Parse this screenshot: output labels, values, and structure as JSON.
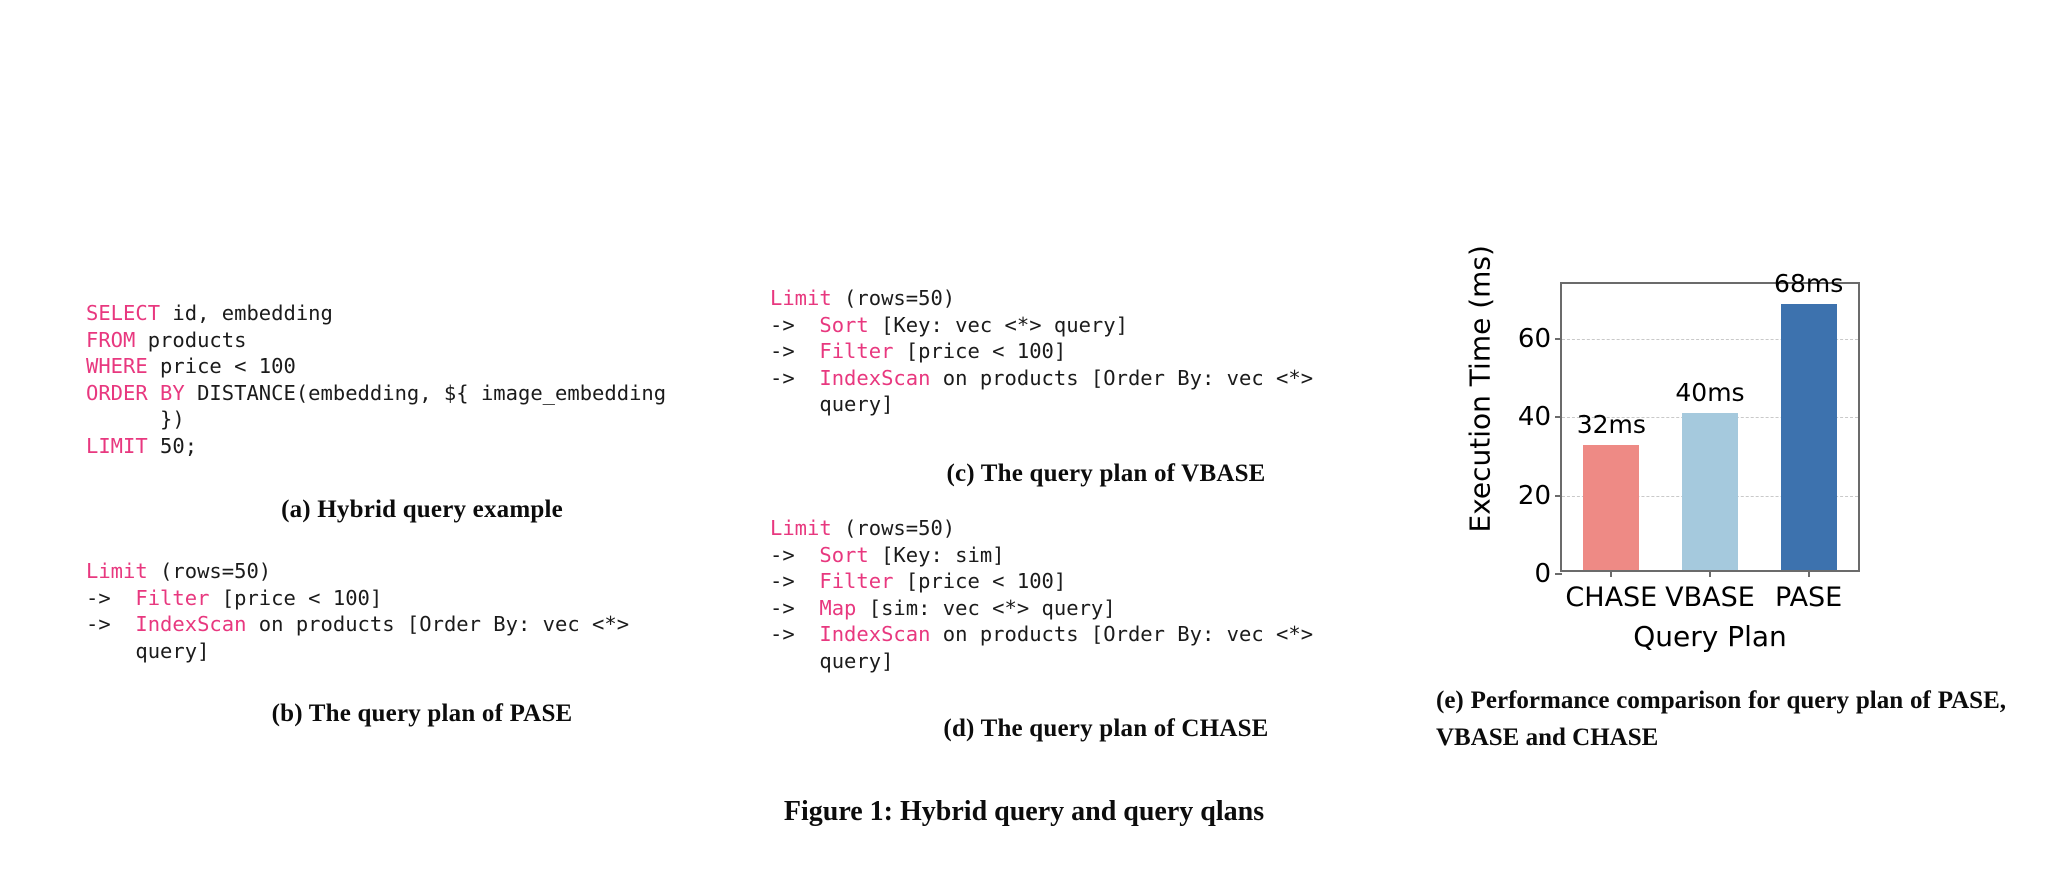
{
  "figure": {
    "caption": "Figure 1: Hybrid query and query qlans"
  },
  "panel_a": {
    "caption": "(a) Hybrid query example",
    "lines": [
      [
        {
          "t": "SELECT",
          "c": "kw"
        },
        {
          "t": " id, embedding",
          "c": "op"
        }
      ],
      [
        {
          "t": "FROM",
          "c": "kw"
        },
        {
          "t": " products",
          "c": "op"
        }
      ],
      [
        {
          "t": "WHERE",
          "c": "kw"
        },
        {
          "t": " price < 100",
          "c": "op"
        }
      ],
      [
        {
          "t": "ORDER BY",
          "c": "kw"
        },
        {
          "t": " DISTANCE(embedding, ${ image_embedding",
          "c": "op"
        }
      ],
      [
        {
          "t": "      })",
          "c": "op"
        }
      ],
      [
        {
          "t": "LIMIT",
          "c": "kw"
        },
        {
          "t": " 50;",
          "c": "op"
        }
      ]
    ]
  },
  "panel_b": {
    "caption": "(b) The query plan of PASE",
    "lines": [
      [
        {
          "t": "Limit",
          "c": "kw"
        },
        {
          "t": " (rows=50)",
          "c": "op"
        }
      ],
      [
        {
          "t": "->  ",
          "c": "op"
        },
        {
          "t": "Filter",
          "c": "kw"
        },
        {
          "t": " [price < 100]",
          "c": "op"
        }
      ],
      [
        {
          "t": "->  ",
          "c": "op"
        },
        {
          "t": "IndexScan",
          "c": "kw"
        },
        {
          "t": " on products [Order By: vec <*>",
          "c": "op"
        }
      ],
      [
        {
          "t": "    query]",
          "c": "op"
        }
      ]
    ]
  },
  "panel_c": {
    "caption": "(c) The query plan of VBASE",
    "lines": [
      [
        {
          "t": "Limit",
          "c": "kw"
        },
        {
          "t": " (rows=50)",
          "c": "op"
        }
      ],
      [
        {
          "t": "->  ",
          "c": "op"
        },
        {
          "t": "Sort",
          "c": "kw"
        },
        {
          "t": " [Key: vec <*> query]",
          "c": "op"
        }
      ],
      [
        {
          "t": "->  ",
          "c": "op"
        },
        {
          "t": "Filter",
          "c": "kw"
        },
        {
          "t": " [price < 100]",
          "c": "op"
        }
      ],
      [
        {
          "t": "->  ",
          "c": "op"
        },
        {
          "t": "IndexScan",
          "c": "kw"
        },
        {
          "t": " on products [Order By: vec <*>",
          "c": "op"
        }
      ],
      [
        {
          "t": "    query]",
          "c": "op"
        }
      ]
    ]
  },
  "panel_d": {
    "caption": "(d) The query plan of CHASE",
    "lines": [
      [
        {
          "t": "Limit",
          "c": "kw"
        },
        {
          "t": " (rows=50)",
          "c": "op"
        }
      ],
      [
        {
          "t": "->  ",
          "c": "op"
        },
        {
          "t": "Sort",
          "c": "kw"
        },
        {
          "t": " [Key: sim]",
          "c": "op"
        }
      ],
      [
        {
          "t": "->  ",
          "c": "op"
        },
        {
          "t": "Filter",
          "c": "kw"
        },
        {
          "t": " [price < 100]",
          "c": "op"
        }
      ],
      [
        {
          "t": "->  ",
          "c": "op"
        },
        {
          "t": "Map",
          "c": "kw"
        },
        {
          "t": " [sim: vec <*> query]",
          "c": "op"
        }
      ],
      [
        {
          "t": "->  ",
          "c": "op"
        },
        {
          "t": "IndexScan",
          "c": "kw"
        },
        {
          "t": " on products [Order By: vec <*>",
          "c": "op"
        }
      ],
      [
        {
          "t": "    query]",
          "c": "op"
        }
      ]
    ]
  },
  "panel_e": {
    "caption": "(e) Performance comparison for query plan of PASE, VBASE and CHASE"
  },
  "chart_data": {
    "type": "bar",
    "title": "",
    "xlabel": "Query Plan",
    "ylabel": "Execution Time (ms)",
    "categories": [
      "CHASE",
      "VBASE",
      "PASE"
    ],
    "values": [
      32,
      40,
      68
    ],
    "data_labels": [
      "32ms",
      "40ms",
      "68ms"
    ],
    "colors": [
      "#ee8a85",
      "#a5c9dd",
      "#3d72ae"
    ],
    "ylim": [
      0,
      74
    ],
    "yticks": [
      0,
      20,
      40,
      60
    ],
    "ytick_labels": [
      "0",
      "20",
      "40",
      "60"
    ],
    "grid": "horizontal-dashed",
    "legend": "none"
  },
  "colors": {
    "keyword_pink": "#e8387f",
    "code_text": "#1b1b1b",
    "axis": "#6b6b6b",
    "grid": "#c9c9c9"
  }
}
